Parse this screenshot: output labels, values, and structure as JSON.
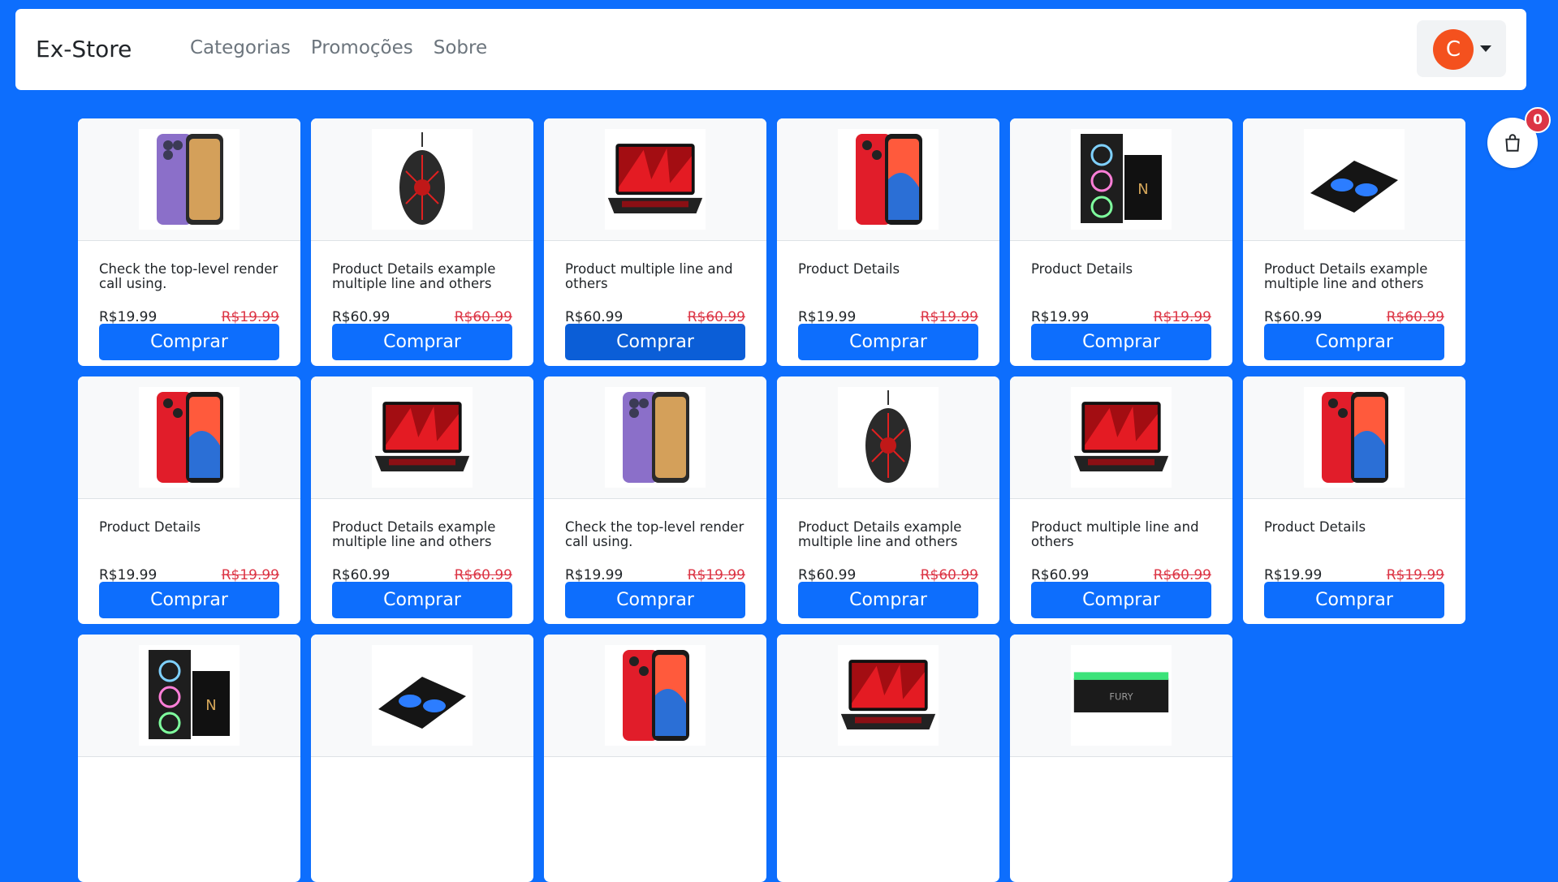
{
  "header": {
    "brand": "Ex-Store",
    "nav": [
      "Categorias",
      "Promoções",
      "Sobre"
    ],
    "avatar_letter": "C"
  },
  "cart": {
    "count": "0"
  },
  "colors": {
    "primary": "#0d6efd",
    "sale": "#dc3545",
    "avatar": "#f4511e"
  },
  "buy_label": "Comprar",
  "products": [
    {
      "title": "Check the top-level render call using.",
      "price": "R$19.99",
      "old_price": "R$19.99",
      "image": "phone-purple"
    },
    {
      "title": "Product Details example multiple line and others",
      "price": "R$60.99",
      "old_price": "R$60.99",
      "image": "mouse"
    },
    {
      "title": "Product multiple line and others",
      "price": "R$60.99",
      "old_price": "R$60.99",
      "image": "laptop"
    },
    {
      "title": "Product Details",
      "price": "R$19.99",
      "old_price": "R$19.99",
      "image": "phone-red"
    },
    {
      "title": "Product Details",
      "price": "R$19.99",
      "old_price": "R$19.99",
      "image": "pc-case"
    },
    {
      "title": "Product Details example multiple line and others",
      "price": "R$60.99",
      "old_price": "R$60.99",
      "image": "cooler"
    },
    {
      "title": "Product Details",
      "price": "R$19.99",
      "old_price": "R$19.99",
      "image": "phone-red"
    },
    {
      "title": "Product Details example multiple line and others",
      "price": "R$60.99",
      "old_price": "R$60.99",
      "image": "laptop"
    },
    {
      "title": "Check the top-level render call using.",
      "price": "R$19.99",
      "old_price": "R$19.99",
      "image": "phone-purple"
    },
    {
      "title": "Product Details example multiple line and others",
      "price": "R$60.99",
      "old_price": "R$60.99",
      "image": "mouse"
    },
    {
      "title": "Product multiple line and others",
      "price": "R$60.99",
      "old_price": "R$60.99",
      "image": "laptop"
    },
    {
      "title": "Product Details",
      "price": "R$19.99",
      "old_price": "R$19.99",
      "image": "phone-red"
    },
    {
      "title": "",
      "price": "",
      "old_price": "",
      "image": "pc-case"
    },
    {
      "title": "",
      "price": "",
      "old_price": "",
      "image": "cooler"
    },
    {
      "title": "",
      "price": "",
      "old_price": "",
      "image": "phone-red"
    },
    {
      "title": "",
      "price": "",
      "old_price": "",
      "image": "laptop"
    },
    {
      "title": "",
      "price": "",
      "old_price": "",
      "image": "ram"
    }
  ]
}
